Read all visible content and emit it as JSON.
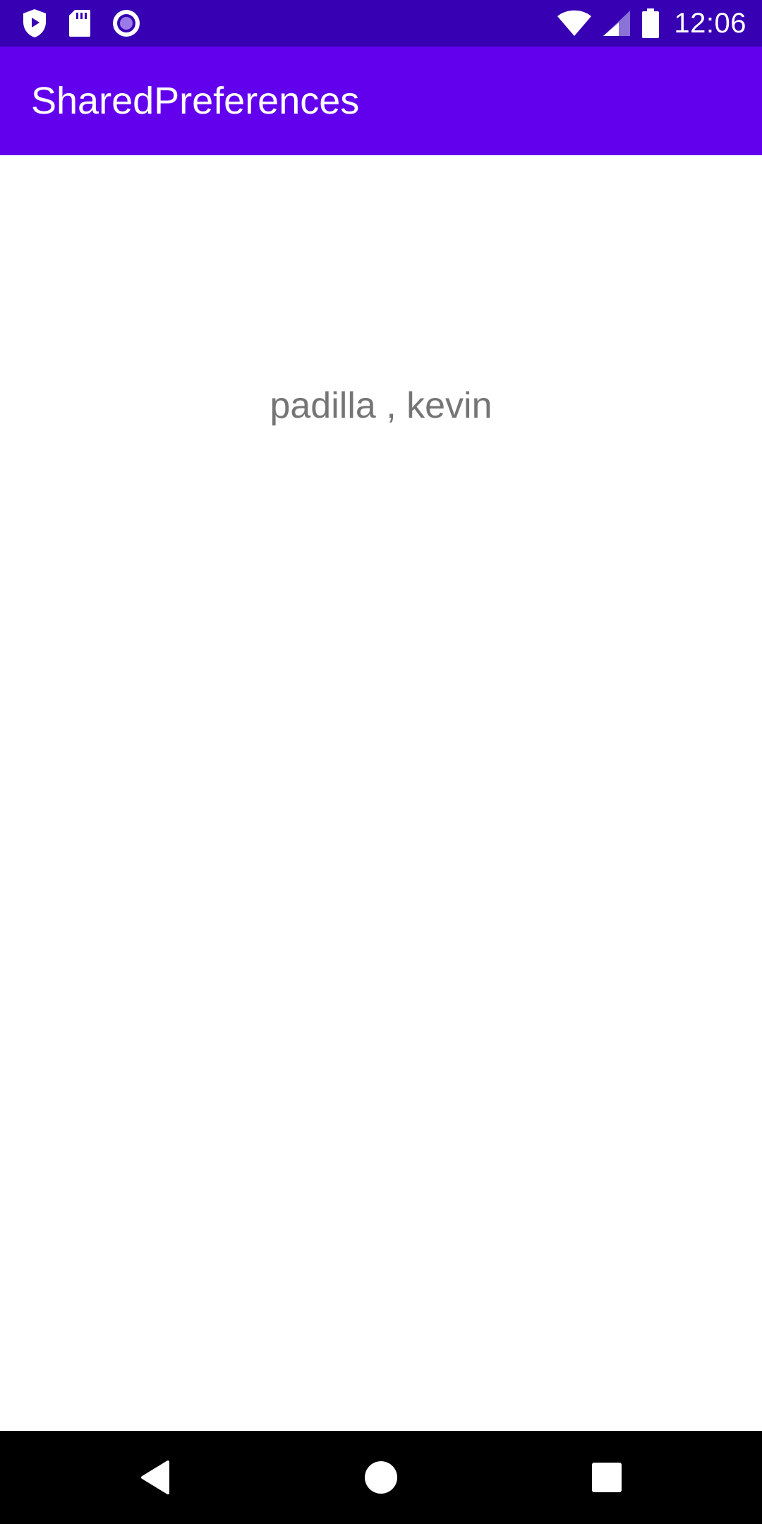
{
  "status_bar": {
    "time": "12:06",
    "left_icons": [
      "shield-play-icon",
      "sd-card-icon",
      "record-icon"
    ],
    "right_icons": [
      "wifi-icon",
      "cell-signal-icon",
      "battery-icon"
    ],
    "background": "#3700b3"
  },
  "app_bar": {
    "title": "SharedPreferences",
    "background": "#6200ee"
  },
  "content": {
    "saved_value": "padilla , kevin"
  },
  "nav_bar": {
    "buttons": [
      "back-icon",
      "home-icon",
      "recents-icon"
    ]
  }
}
